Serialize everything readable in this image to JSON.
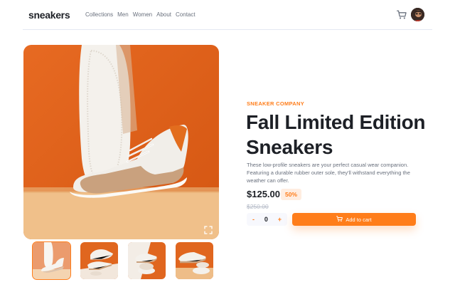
{
  "header": {
    "logo": "sneakers",
    "nav": [
      "Collections",
      "Men",
      "Women",
      "About",
      "Contact"
    ],
    "icons": [
      "cart-icon",
      "avatar"
    ]
  },
  "product": {
    "company": "SNEAKER COMPANY",
    "title": "Fall Limited Edition Sneakers",
    "description": "These low-profile sneakers are your perfect casual wear companion. Featuring a durable rubber outer sole, they'll withstand everything the weather can offer.",
    "price": "$125.00",
    "discount": "50%",
    "old_price": "$250.00",
    "quantity": "0",
    "minus": "-",
    "plus": "+",
    "add_to_cart": "Add to cart"
  },
  "colors": {
    "accent": "#ff7d1a",
    "accent_light": "#ffede0",
    "text_dark": "#1d2026",
    "text_muted": "#69707d"
  },
  "gallery": {
    "selected_thumbnail_index": 0,
    "thumbnail_count": 4,
    "icons": [
      "expand-icon"
    ]
  }
}
